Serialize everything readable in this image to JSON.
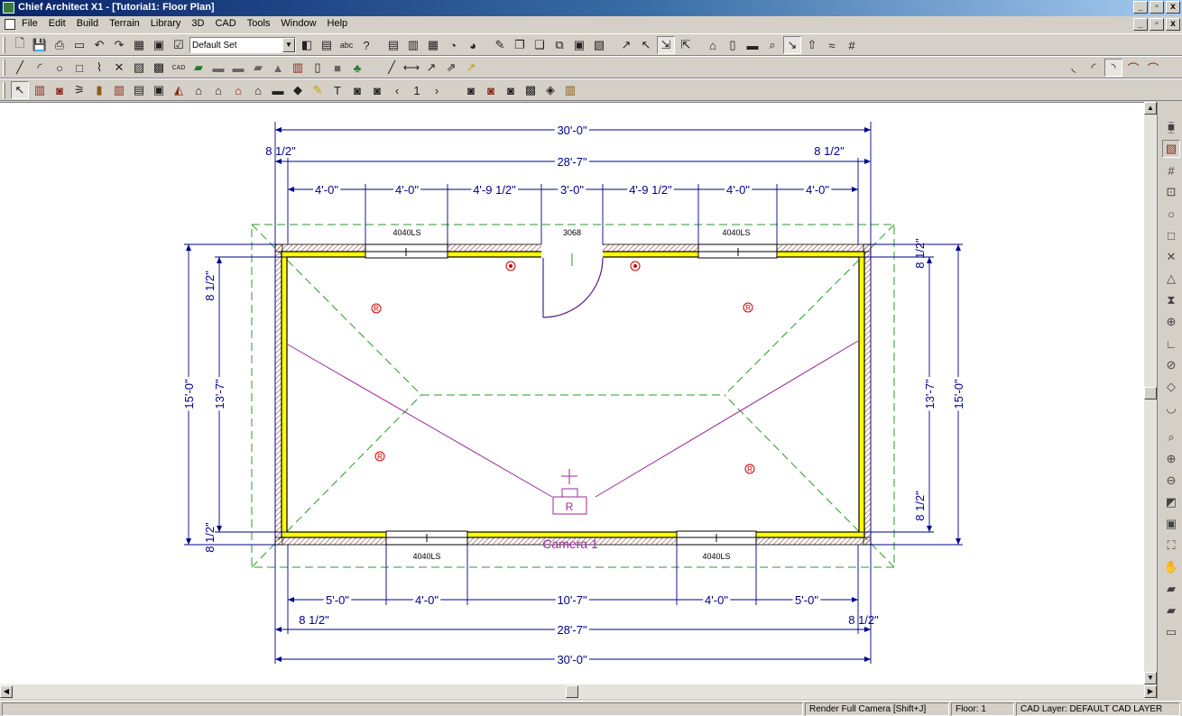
{
  "window": {
    "title": "Chief Architect X1 - [Tutorial1: Floor Plan]",
    "min": "_",
    "restore": "▫",
    "close": "x"
  },
  "menu": [
    "File",
    "Edit",
    "Build",
    "Terrain",
    "Library",
    "3D",
    "CAD",
    "Tools",
    "Window",
    "Help"
  ],
  "toolbar": {
    "layer_set": "Default Set"
  },
  "plan": {
    "dims": {
      "top_overall": "30'-0\"",
      "top_interior": "28'-7\"",
      "top_left_wall": "8 1/2\"",
      "top_right_wall": "8 1/2\"",
      "top_segments": [
        "4'-0\"",
        "4'-0\"",
        "4'-9 1/2\"",
        "3'-0\"",
        "4'-9 1/2\"",
        "4'-0\"",
        "4'-0\""
      ],
      "bottom_segments": [
        "5'-0\"",
        "4'-0\"",
        "10'-7\"",
        "4'-0\"",
        "5'-0\""
      ],
      "bottom_left_wall": "8 1/2\"",
      "bottom_right_wall": "8 1/2\"",
      "bottom_interior": "28'-7\"",
      "bottom_overall": "30'-0\"",
      "left_overall": "15'-0\"",
      "left_interior": "13'-7\"",
      "left_top_wall": "8 1/2\"",
      "left_bottom_wall": "8 1/2\"",
      "right_overall": "15'-0\"",
      "right_interior": "13'-7\"",
      "right_top_wall": "8 1/2\"",
      "right_bottom_wall": "8 1/2\""
    },
    "windows": {
      "top_left": "4040LS",
      "door": "3068",
      "top_right": "4040LS",
      "bottom_left": "4040LS",
      "bottom_right": "4040LS"
    },
    "camera": {
      "label": "Camera 1",
      "marker": "R"
    }
  },
  "status": {
    "message": "Render Full Camera [Shift+J]",
    "floor": "Floor: 1",
    "cad_layer": "CAD Layer:  DEFAULT CAD LAYER"
  }
}
